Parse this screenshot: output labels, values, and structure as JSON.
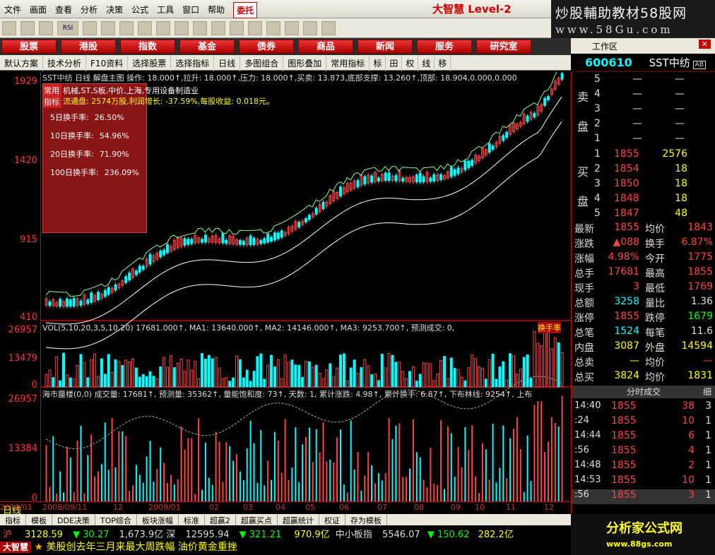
{
  "menu": [
    "文件",
    "画面",
    "查看",
    "分析",
    "决策",
    "公式",
    "工具",
    "窗口",
    "帮助"
  ],
  "menu_trade": "委托",
  "brand": "大智慧 Level-2",
  "banner": {
    "line1": "炒股輔助教材58股网",
    "line2": "www.58Gu.com"
  },
  "toolbar_icons": [
    "open-icon",
    "image-icon",
    "chart-icon",
    "rsi-icon",
    "grid-icon",
    "cross-icon",
    "pen-icon",
    "dollar-icon",
    "flag-icon",
    "binoculars-icon",
    "expand-icon",
    "house-icon",
    "diamond-icon",
    "red-circle-icon",
    "blue-circle-icon",
    "doc-icon",
    "bars-icon",
    "pointer-icon"
  ],
  "toolbar_rsi": "RSI",
  "tabs": [
    "股票",
    "港股",
    "指数",
    "基金",
    "债券",
    "商品",
    "新闻",
    "服务",
    "研究室"
  ],
  "subtool": [
    "默认方案",
    "技术分析",
    "F10资料",
    "选择股票",
    "选择指标",
    "日线",
    "多图组合",
    "图形叠加",
    "常用指标"
  ],
  "subtool_right": [
    "标",
    "田",
    "权",
    "线",
    "移"
  ],
  "panel": {
    "title": "工作区",
    "code": "600610",
    "name": "SST中纺",
    "tag": "AB"
  },
  "axis": {
    "price": [
      "1929",
      "1420",
      "915",
      "410"
    ],
    "vol": [
      "26957",
      "13479",
      "0"
    ],
    "mk": [
      "26957",
      "13384",
      "0"
    ]
  },
  "info_line": "SST中纺 日线 解盘主图 操作: 18.000↑,拉升: 18.000↑,压力: 18.000↑,买卖: 13.873,底部支撑: 13.260↑,顶部: 18.904,0.000,0.000",
  "popup": {
    "head": "常用指标",
    "desc": "机械,ST,S板,中价,上海,专用设备制造业",
    "info": "流通盘: 2574万股,利润增长: -37.59%,每股收益: 0.018元。",
    "rates": [
      {
        "k": "5日换手率:",
        "v": "26.50%"
      },
      {
        "k": "10日换手率:",
        "v": "54.96%"
      },
      {
        "k": "20日换手率:",
        "v": "71.90%"
      },
      {
        "k": "100日换手率:",
        "v": "236.09%"
      }
    ]
  },
  "vol_line": "VOL(5,10,20,3,5,10,20) 17681.000↑, MA1: 13640.000↑, MA2: 14146.000↑, MA3: 9253.700↑, 预测成交: 0,",
  "vol_tag": "换手率",
  "mk_line": "海市蜃楼(0,0) 成交量: 17681↑, 预测量: 35362↑, 量能饱和度: 73↑, 天数: 1, 累计涨跌: 4.98↑, 累计换手: 6.87↑, 下布林线: 9254↑, 上布",
  "dates": [
    "日线",
    "2008/09/11",
    "12",
    "2009/01",
    "02",
    "03",
    "04",
    "05",
    "06",
    "07",
    "08",
    "09",
    "10",
    "11",
    "12",
    "2010/01"
  ],
  "btabs": [
    "指标",
    "模板",
    "DDE决策",
    "TOP综合",
    "板块涨幅",
    "标准",
    "超赢2",
    "超赢买点",
    "超赢统计",
    "权证",
    "存为模板"
  ],
  "ticker": {
    "sh": "沪",
    "sh_idx": "3128.59",
    "sh_chg": "▼ 30.27",
    "sh_amt": "1,673.9亿",
    "sz": "深",
    "sz_idx": "12595.94",
    "sz_chg": "▼ 321.21",
    "sz_amt": "970.9亿",
    "mid": "中小板指",
    "mid_idx": "5546.07",
    "mid_chg": "▼ 150.62",
    "mid_amt": "282.2亿"
  },
  "news": "美股创去年三月来最大周跌幅 油价黄金重挫",
  "news_brand": "大智慧",
  "sell": [
    {
      "n": "5",
      "p": "—",
      "q": "—"
    },
    {
      "n": "4",
      "p": "—",
      "q": "—"
    },
    {
      "n": "3",
      "p": "—",
      "q": "—"
    },
    {
      "n": "2",
      "p": "—",
      "q": "—"
    },
    {
      "n": "1",
      "p": "—",
      "q": "—"
    }
  ],
  "buy": [
    {
      "n": "1",
      "p": "1855",
      "q": "2576"
    },
    {
      "n": "2",
      "p": "1854",
      "q": "18"
    },
    {
      "n": "3",
      "p": "1850",
      "q": "18"
    },
    {
      "n": "4",
      "p": "1848",
      "q": "18"
    },
    {
      "n": "5",
      "p": "1847",
      "q": "48"
    }
  ],
  "sell_label": [
    "卖",
    "盘"
  ],
  "buy_label": [
    "买",
    "盘"
  ],
  "stats": [
    {
      "k": "最新",
      "v": "1855",
      "k2": "均价",
      "v2": "1843"
    },
    {
      "k": "涨跌",
      "v": "▲088",
      "k2": "换手",
      "v2": "6.87%"
    },
    {
      "k": "涨幅",
      "v": "4.98%",
      "k2": "今开",
      "v2": "1775"
    },
    {
      "k": "总手",
      "v": "17681",
      "k2": "最高",
      "v2": "1855"
    },
    {
      "k": "现手",
      "v": "3",
      "k2": "最低",
      "v2": "1769"
    },
    {
      "k": "总额",
      "v": "3258",
      "k2": "量比",
      "v2": "1.36"
    },
    {
      "k": "涨停",
      "v": "1855",
      "k2": "跌停",
      "v2": "1679"
    },
    {
      "k": "总笔",
      "v": "1524",
      "k2": "每笔",
      "v2": "11.6"
    },
    {
      "k": "内盘",
      "v": "3087",
      "k2": "外盘",
      "v2": "14594"
    },
    {
      "k": "总卖",
      "v": "—",
      "k2": "均价",
      "v2": "—"
    },
    {
      "k": "总买",
      "v": "3824",
      "k2": "均价",
      "v2": "1831"
    }
  ],
  "trades_title": "分时成交",
  "trades_btn": "细",
  "trades": [
    {
      "t": "14:40",
      "p": "1855",
      "q": "38",
      "n": "3"
    },
    {
      "t": ":24",
      "p": "1855",
      "q": "10",
      "n": "1"
    },
    {
      "t": "14:44",
      "p": "1855",
      "q": "6",
      "n": "1"
    },
    {
      "t": ":56",
      "p": "1855",
      "q": "4",
      "n": "1"
    },
    {
      "t": "14:48",
      "p": "1855",
      "q": "2",
      "n": "1"
    },
    {
      "t": "14:53",
      "p": "1855",
      "q": "10",
      "n": "1"
    },
    {
      "t": ":56",
      "p": "1855",
      "q": "3",
      "n": "1"
    }
  ],
  "logo": {
    "line1": "分析家公式网",
    "line2": "www.88gs.com"
  }
}
